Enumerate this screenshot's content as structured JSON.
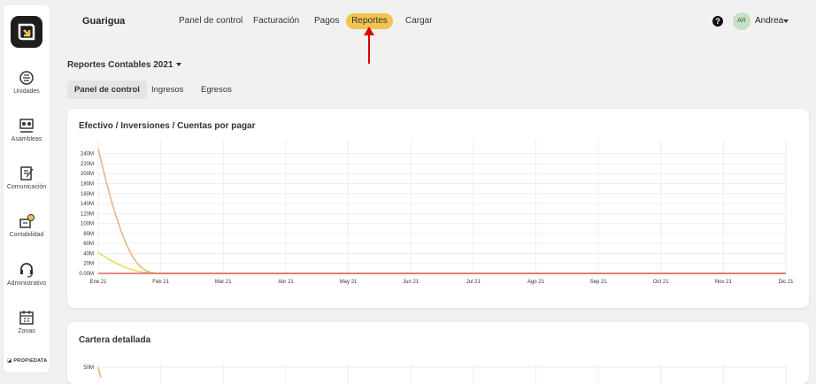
{
  "sidebar": {
    "items": [
      {
        "label": "Unidades",
        "icon": "unit-icon"
      },
      {
        "label": "Asambleas",
        "icon": "assembly-icon"
      },
      {
        "label": "Comunicación",
        "icon": "communication-icon"
      },
      {
        "label": "Contabilidad",
        "icon": "accounting-icon"
      },
      {
        "label": "Administrativo",
        "icon": "support-icon"
      },
      {
        "label": "Zonas",
        "icon": "calendar-icon"
      }
    ],
    "brand": "PROPIEDATA"
  },
  "header": {
    "app_title": "Guarigua",
    "nav": [
      "Panel de control",
      "Facturación",
      "Pagos",
      "Reportes",
      "Cargar"
    ],
    "active_nav": "Reportes",
    "help": "?",
    "avatar_initials": "AR",
    "user_name": "Andrea"
  },
  "report": {
    "title": "Reportes Contables 2021",
    "tabs": [
      "Panel de control",
      "Ingresos",
      "Egresos"
    ]
  },
  "colors": {
    "accent": "#f1c34f",
    "annotation": "#e00000",
    "series_orange": "#e8b48a",
    "series_yellow": "#eedc5a",
    "series_red": "#e06060"
  },
  "chart_data": [
    {
      "type": "line",
      "title": "Efectivo / Inversiones / Cuentas por pagar",
      "x": [
        "Ene 21",
        "Feb 21",
        "Mar 21",
        "Abr 21",
        "May 21",
        "Jun 21",
        "Jul 21",
        "Ago 21",
        "Sep 21",
        "Oct 21",
        "Nov 21",
        "Dic 21"
      ],
      "y_ticks": [
        "0.00M",
        "20M",
        "40M",
        "60M",
        "80M",
        "100M",
        "120M",
        "140M",
        "160M",
        "180M",
        "200M",
        "220M",
        "240M"
      ],
      "ylim": [
        0,
        250
      ],
      "grid": true,
      "series": [
        {
          "color": "#e8b48a",
          "values": [
            250,
            0,
            0,
            0,
            0,
            0,
            0,
            0,
            0,
            0,
            0,
            0
          ]
        },
        {
          "color": "#eedc5a",
          "values": [
            42,
            0,
            0,
            0,
            0,
            0,
            0,
            0,
            0,
            0,
            0,
            0
          ]
        },
        {
          "color": "#e06060",
          "values": [
            0,
            0,
            0,
            0,
            0,
            0,
            0,
            0,
            0,
            0,
            0,
            0
          ]
        }
      ]
    },
    {
      "type": "line",
      "title": "Cartera detallada",
      "y_ticks": [
        "50M"
      ],
      "grid": true
    }
  ]
}
